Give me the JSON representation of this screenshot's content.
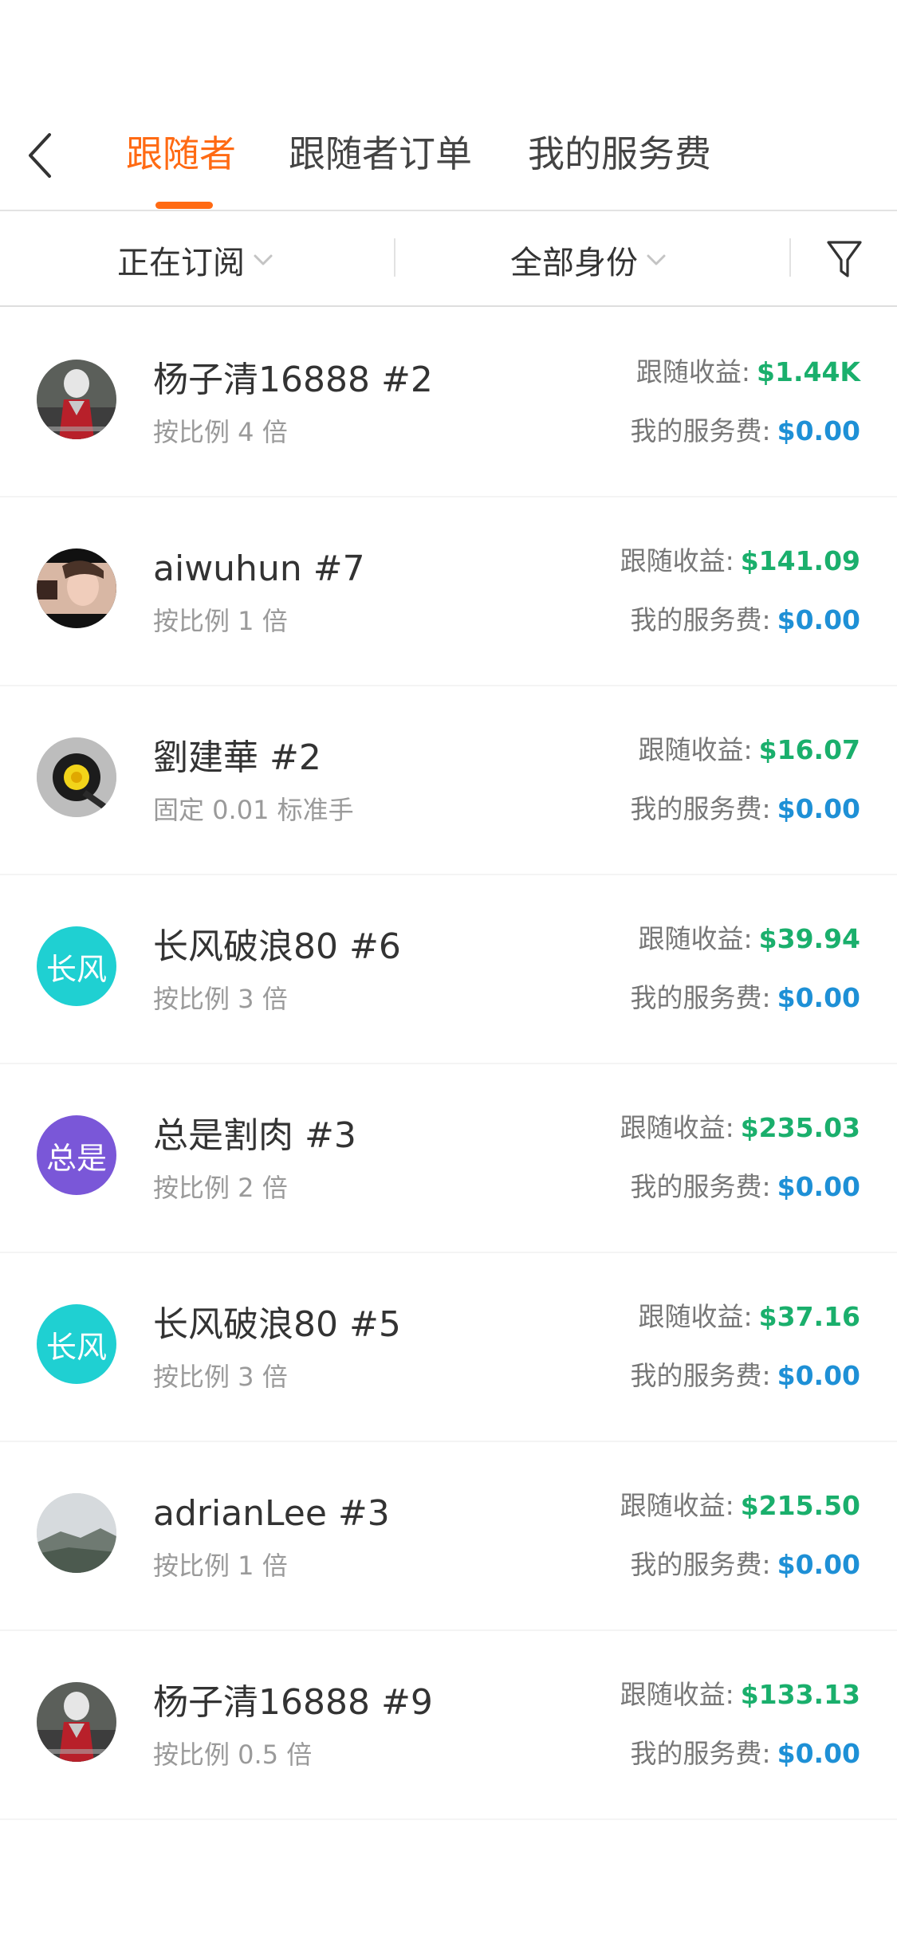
{
  "header": {
    "tabs": [
      {
        "label": "跟随者",
        "active": true
      },
      {
        "label": "跟随者订单",
        "active": false
      },
      {
        "label": "我的服务费",
        "active": false
      }
    ]
  },
  "filters": {
    "subscription": "正在订阅",
    "identity": "全部身份"
  },
  "labels": {
    "earnings": "跟随收益:",
    "fee": "我的服务费:"
  },
  "colors": {
    "accent": "#ff6a13",
    "earnings": "#1aaf6c",
    "fee": "#1e90d6"
  },
  "followers": [
    {
      "name": "杨子清16888 #2",
      "ratio": "按比例 4 倍",
      "earnings": "$1.44K",
      "fee": "$0.00",
      "avatar": {
        "type": "photo",
        "icon": "hero-photo-icon"
      }
    },
    {
      "name": "aiwuhun #7",
      "ratio": "按比例 1 倍",
      "earnings": "$141.09",
      "fee": "$0.00",
      "avatar": {
        "type": "photo",
        "icon": "portrait-photo-icon"
      }
    },
    {
      "name": "劉建華 #2",
      "ratio": "固定 0.01 标准手",
      "earnings": "$16.07",
      "fee": "$0.00",
      "avatar": {
        "type": "photo",
        "icon": "flower-photo-icon"
      }
    },
    {
      "name": "长风破浪80 #6",
      "ratio": "按比例 3 倍",
      "earnings": "$39.94",
      "fee": "$0.00",
      "avatar": {
        "type": "text",
        "text": "长风",
        "color": "#1fd0d2"
      }
    },
    {
      "name": "总是割肉 #3",
      "ratio": "按比例 2 倍",
      "earnings": "$235.03",
      "fee": "$0.00",
      "avatar": {
        "type": "text",
        "text": "总是",
        "color": "#7a57d8"
      }
    },
    {
      "name": "长风破浪80 #5",
      "ratio": "按比例 3 倍",
      "earnings": "$37.16",
      "fee": "$0.00",
      "avatar": {
        "type": "text",
        "text": "长风",
        "color": "#1fd0d2"
      }
    },
    {
      "name": "adrianLee #3",
      "ratio": "按比例 1 倍",
      "earnings": "$215.50",
      "fee": "$0.00",
      "avatar": {
        "type": "photo",
        "icon": "mountain-photo-icon"
      }
    },
    {
      "name": "杨子清16888 #9",
      "ratio": "按比例 0.5 倍",
      "earnings": "$133.13",
      "fee": "$0.00",
      "avatar": {
        "type": "photo",
        "icon": "hero-photo-icon"
      }
    }
  ]
}
